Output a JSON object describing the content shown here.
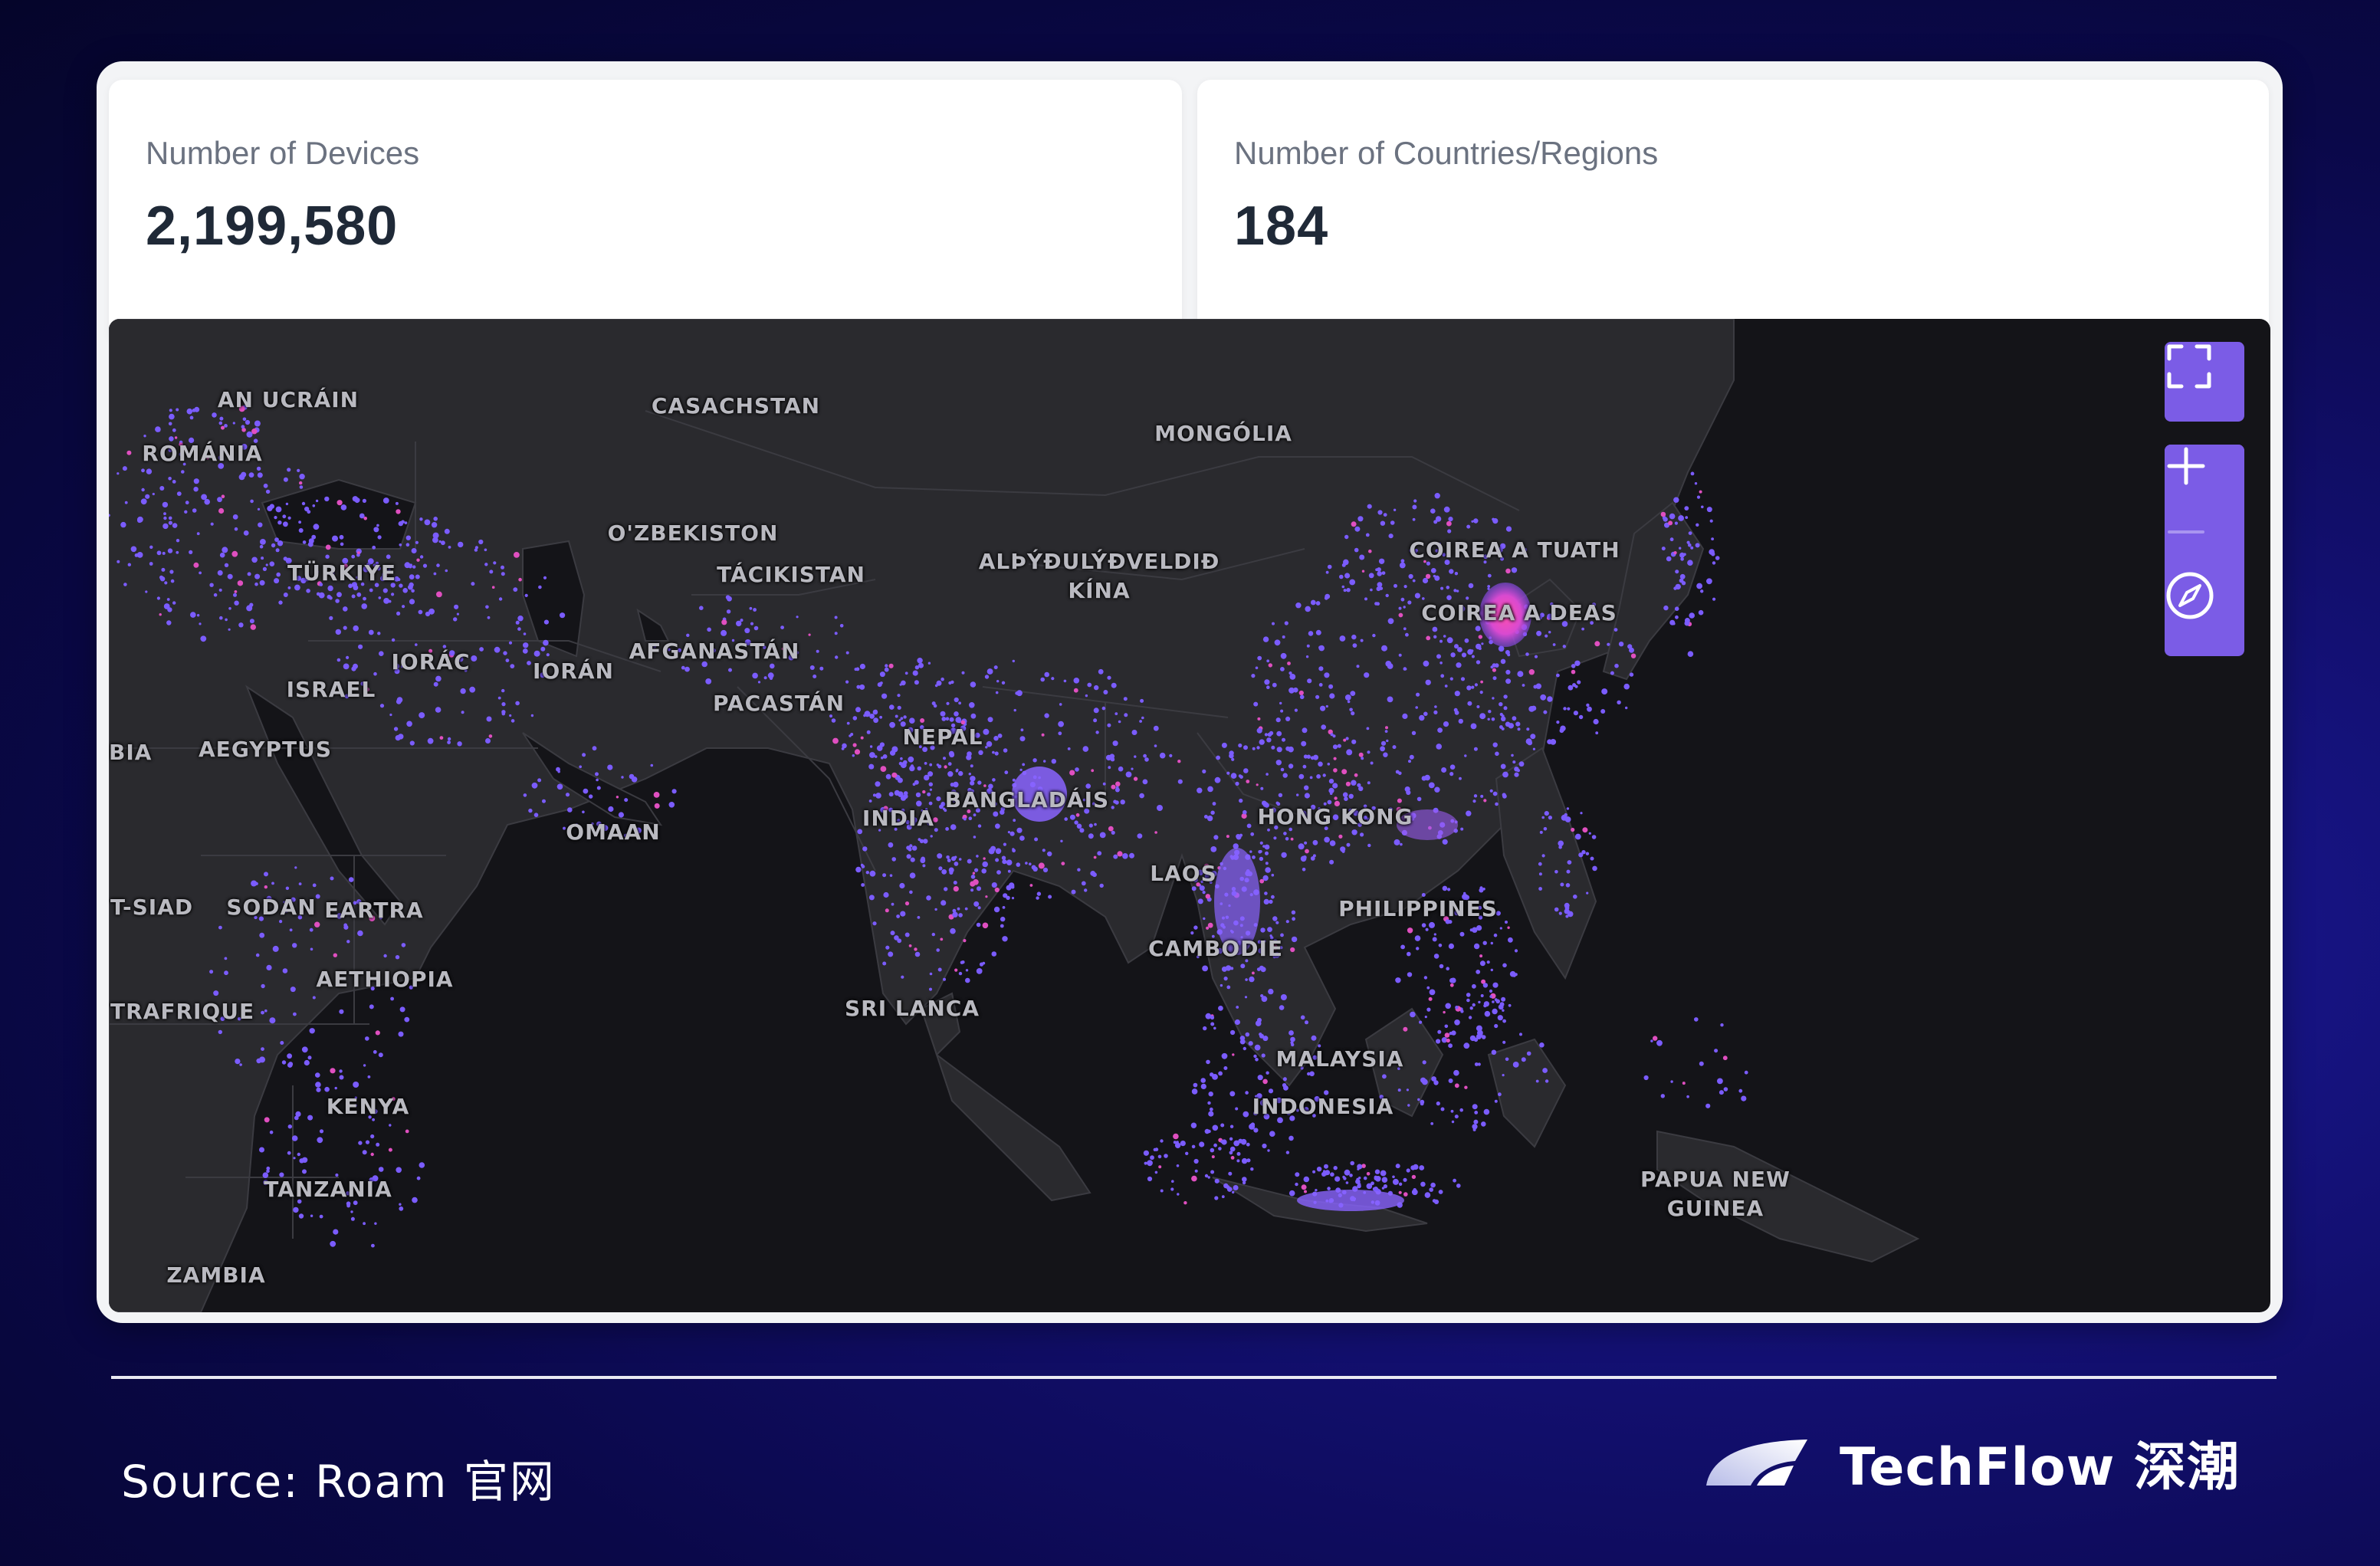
{
  "stats": {
    "devices": {
      "label": "Number of Devices",
      "value": "2,199,580"
    },
    "countries": {
      "label": "Number of Countries/Regions",
      "value": "184"
    }
  },
  "map": {
    "labels": [
      {
        "id": "ukraine",
        "text": "AN UCRÁIN"
      },
      {
        "id": "romania",
        "text": "ROMÁNIA"
      },
      {
        "id": "kazakhstan",
        "text": "CASACHSTAN"
      },
      {
        "id": "mongolia",
        "text": "MONGÓLIA"
      },
      {
        "id": "uzbekistan",
        "text": "O'ZBEKISTON"
      },
      {
        "id": "tajikistan",
        "text": "TÁCIKISTAN"
      },
      {
        "id": "turkey",
        "text": "TÜRKIYE"
      },
      {
        "id": "china",
        "text": "ALÞÝÐULÝÐVELDIÐ\nKÍNA"
      },
      {
        "id": "north-korea",
        "text": "COIREA A TUATH"
      },
      {
        "id": "south-korea",
        "text": "COIREA A DEAS"
      },
      {
        "id": "iraq",
        "text": "IORÁC"
      },
      {
        "id": "iran",
        "text": "IORÁN"
      },
      {
        "id": "afghanistan",
        "text": "AFGANASTÁN"
      },
      {
        "id": "israel",
        "text": "ISRAEL"
      },
      {
        "id": "pakistan",
        "text": "PACASTÁN"
      },
      {
        "id": "nepal",
        "text": "NEPAL"
      },
      {
        "id": "bia",
        "text": "BIA"
      },
      {
        "id": "egypt",
        "text": "AEGYPTUS"
      },
      {
        "id": "india",
        "text": "INDIA"
      },
      {
        "id": "bangladesh",
        "text": "BANGLADÁIS"
      },
      {
        "id": "hong-kong",
        "text": "HONG KONG"
      },
      {
        "id": "oman",
        "text": "OMAAN"
      },
      {
        "id": "laos",
        "text": "LAOS"
      },
      {
        "id": "chad",
        "text": "T-SIAD"
      },
      {
        "id": "sudan",
        "text": "SODAN"
      },
      {
        "id": "eritrea",
        "text": "EARTRA"
      },
      {
        "id": "philippines",
        "text": "PHILIPPINES"
      },
      {
        "id": "cambodia",
        "text": "CAMBODIE"
      },
      {
        "id": "ethiopia",
        "text": "AETHIOPIA"
      },
      {
        "id": "sri-lanka",
        "text": "SRI LANCA"
      },
      {
        "id": "car",
        "text": "TRAFRIQUE"
      },
      {
        "id": "malaysia",
        "text": "MALAYSIA"
      },
      {
        "id": "kenya",
        "text": "KENYA"
      },
      {
        "id": "indonesia",
        "text": "INDONESIA"
      },
      {
        "id": "papua",
        "text": "PAPUA NEW\nGUINEA"
      },
      {
        "id": "tanzania",
        "text": "TANZANIA"
      },
      {
        "id": "zambia",
        "text": "ZAMBIA"
      }
    ],
    "controls": {
      "fullscreen": "fullscreen-icon",
      "zoom_in": "plus-icon",
      "zoom_out": "minus-icon",
      "compass": "compass-icon"
    },
    "colors": {
      "background": "#141418",
      "land": "#2a2a2e",
      "dots": "#7b5cff",
      "hotspot": "#d04ad8",
      "control": "#7b5ce6"
    }
  },
  "footer": {
    "source": "Source: Roam 官网",
    "brand": "TechFlow 深潮"
  }
}
